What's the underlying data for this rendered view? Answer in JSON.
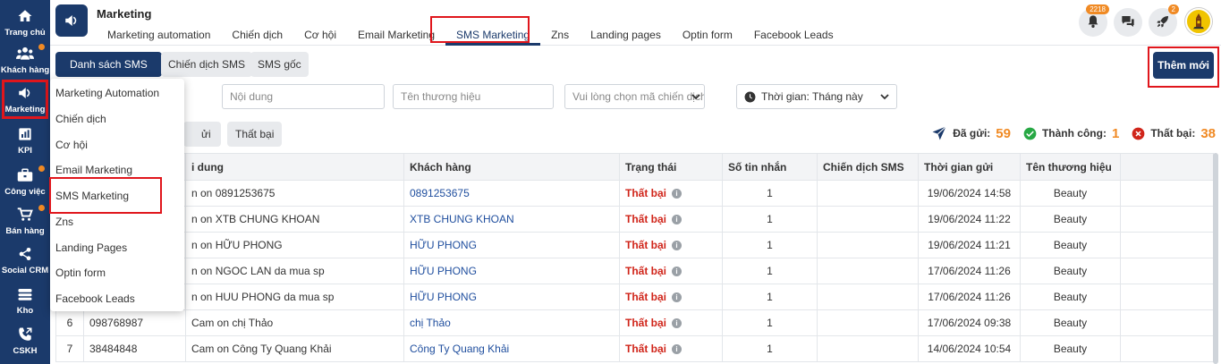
{
  "sidebar": {
    "items": [
      {
        "label": "Trang chủ",
        "icon": "home-icon"
      },
      {
        "label": "Khách hàng",
        "icon": "users-icon"
      },
      {
        "label": "Marketing",
        "icon": "megaphone-icon"
      },
      {
        "label": "KPI",
        "icon": "chart-icon"
      },
      {
        "label": "Công việc",
        "icon": "briefcase-icon"
      },
      {
        "label": "Bán hàng",
        "icon": "cart-icon"
      },
      {
        "label": "Social CRM",
        "icon": "share-icon"
      },
      {
        "label": "Kho",
        "icon": "warehouse-icon"
      },
      {
        "label": "CSKH",
        "icon": "phone-icon"
      }
    ]
  },
  "header": {
    "title": "Marketing",
    "tabs": [
      {
        "label": "Marketing automation"
      },
      {
        "label": "Chiến dịch"
      },
      {
        "label": "Cơ hội"
      },
      {
        "label": "Email Marketing"
      },
      {
        "label": "SMS Marketing"
      },
      {
        "label": "Zns"
      },
      {
        "label": "Landing pages"
      },
      {
        "label": "Optin form"
      },
      {
        "label": "Facebook Leads"
      }
    ],
    "notification_count": "2218",
    "rocket_count": "2"
  },
  "subbar": {
    "tabs": [
      {
        "label": "Danh sách SMS"
      },
      {
        "label": "Chiến dịch SMS"
      },
      {
        "label": "SMS gốc"
      }
    ],
    "add_button": "Thêm mới"
  },
  "filters": {
    "content_placeholder": "Nội dung",
    "brand_placeholder": "Tên thương hiệu",
    "campaign_placeholder": "Vui lòng chọn mã chiến dịch",
    "time_label": "Thời gian: Tháng này"
  },
  "status_filters": {
    "sent_partial": "ửi",
    "failed": "Thất bại"
  },
  "stats": {
    "sent_label": "Đã gửi:",
    "sent_value": "59",
    "success_label": "Thành công:",
    "success_value": "1",
    "failed_label": "Thất bại:",
    "failed_value": "38"
  },
  "colors": {
    "primary": "#1b3a6b",
    "accent_orange": "#f08a24",
    "fail_red": "#d0251a",
    "success_green": "#27a844",
    "highlight_red": "#e0161c"
  },
  "table": {
    "headers": {
      "content": "i dung",
      "customer": "Khách hàng",
      "status": "Trạng thái",
      "msg_count": "Số tin nhắn",
      "campaign": "Chiến dịch SMS",
      "sent_time": "Thời gian gửi",
      "brand": "Tên thương hiệu"
    },
    "rows": [
      {
        "no": "",
        "phone": "",
        "content": "n on 0891253675",
        "customer": "0891253675",
        "status": "Thất bại",
        "count": "1",
        "campaign": "",
        "time": "19/06/2024 14:58",
        "brand": "Beauty"
      },
      {
        "no": "",
        "phone": "",
        "content": "n on XTB CHUNG KHOAN",
        "customer": "XTB CHUNG KHOAN",
        "status": "Thất bại",
        "count": "1",
        "campaign": "",
        "time": "19/06/2024 11:22",
        "brand": "Beauty"
      },
      {
        "no": "",
        "phone": "",
        "content": "n on HỮU PHONG",
        "customer": "HỮU PHONG",
        "status": "Thất bại",
        "count": "1",
        "campaign": "",
        "time": "19/06/2024 11:21",
        "brand": "Beauty"
      },
      {
        "no": "",
        "phone": "",
        "content": "n on NGOC LAN da mua sp",
        "customer": "HỮU PHONG",
        "status": "Thất bại",
        "count": "1",
        "campaign": "",
        "time": "17/06/2024 11:26",
        "brand": "Beauty"
      },
      {
        "no": "",
        "phone": "",
        "content": "n on HUU PHONG da mua sp",
        "customer": "HỮU PHONG",
        "status": "Thất bại",
        "count": "1",
        "campaign": "",
        "time": "17/06/2024 11:26",
        "brand": "Beauty"
      },
      {
        "no": "6",
        "phone": "098768987",
        "content": "Cam on chị Thảo",
        "customer": "chị Thảo",
        "status": "Thất bại",
        "count": "1",
        "campaign": "",
        "time": "17/06/2024 09:38",
        "brand": "Beauty"
      },
      {
        "no": "7",
        "phone": "38484848",
        "content": "Cam on Công Ty Quang Khải",
        "customer": "Công Ty Quang Khải",
        "status": "Thất bại",
        "count": "1",
        "campaign": "",
        "time": "14/06/2024 10:54",
        "brand": "Beauty"
      }
    ]
  },
  "dropdown_menu": {
    "items": [
      {
        "label": "Marketing Automation"
      },
      {
        "label": "Chiến dịch"
      },
      {
        "label": "Cơ hội"
      },
      {
        "label": "Email Marketing"
      },
      {
        "label": "SMS Marketing"
      },
      {
        "label": "Zns"
      },
      {
        "label": "Landing Pages"
      },
      {
        "label": "Optin form"
      },
      {
        "label": "Facebook Leads"
      }
    ]
  }
}
